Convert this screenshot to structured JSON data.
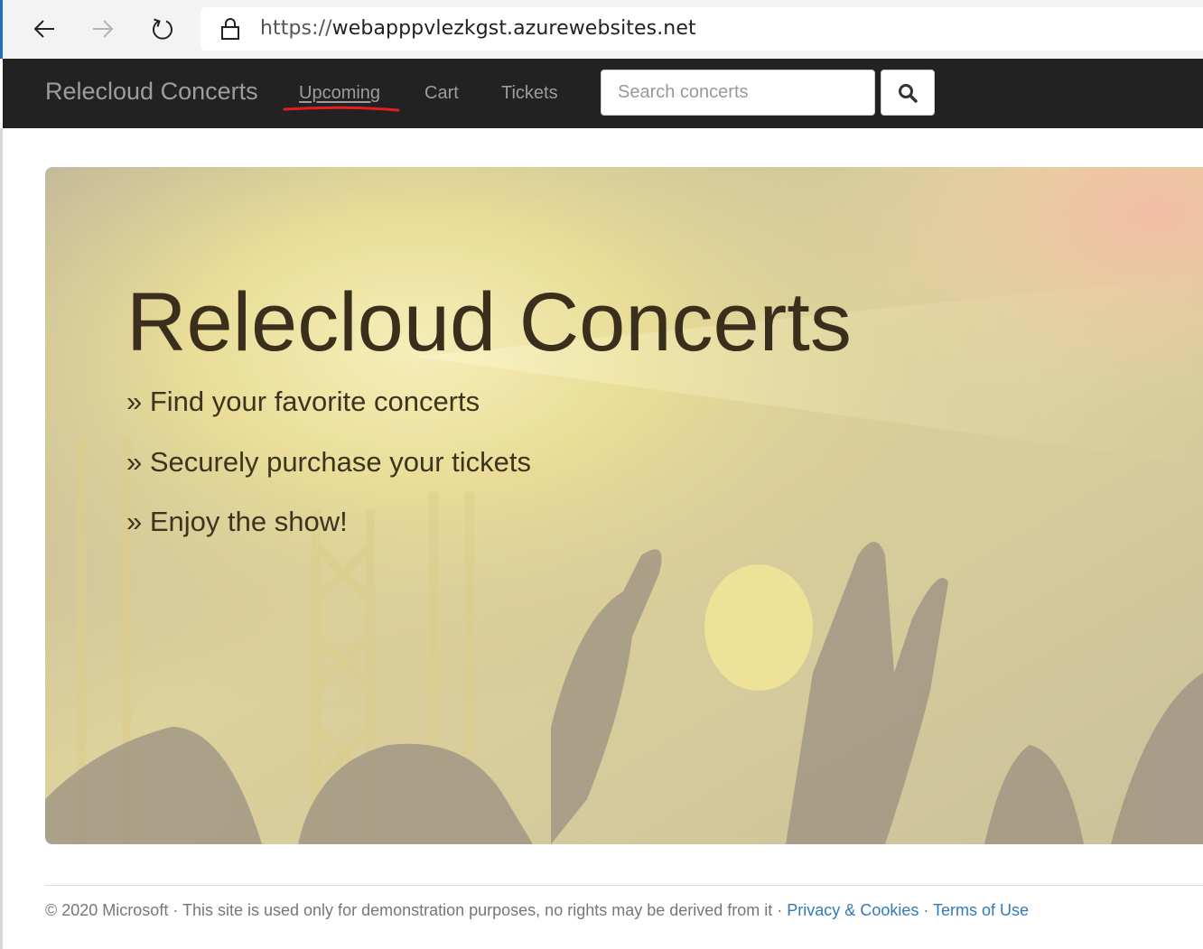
{
  "browser": {
    "url_scheme": "https://",
    "url_host": "webapppvlezkgst.azurewebsites.net"
  },
  "navbar": {
    "brand": "Relecloud Concerts",
    "links": [
      "Upcoming",
      "Cart",
      "Tickets"
    ],
    "active_link": "Upcoming",
    "search_placeholder": "Search concerts"
  },
  "hero": {
    "title": "Relecloud Concerts",
    "points": [
      "» Find your favorite concerts",
      "» Securely purchase your tickets",
      "» Enjoy the show!"
    ]
  },
  "footer": {
    "text": "© 2020 Microsoft · This site is used only for demonstration purposes, no rights may be derived from it · ",
    "privacy_link": "Privacy & Cookies",
    "separator": " · ",
    "terms_link": "Terms of Use"
  },
  "colors": {
    "navbar_bg": "#222222",
    "nav_text": "#9d9d9d",
    "link": "#337ab7",
    "annotation_red": "#e02020"
  },
  "icons": [
    "back-arrow-icon",
    "forward-arrow-icon",
    "refresh-icon",
    "lock-icon",
    "search-icon"
  ]
}
